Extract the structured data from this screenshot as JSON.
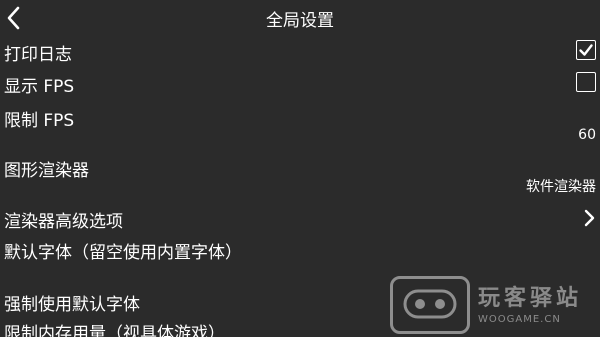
{
  "header": {
    "title": "全局设置",
    "back_icon": "chevron-left-icon"
  },
  "settings": {
    "print_log": {
      "label": "打印日志",
      "checked": true
    },
    "show_fps": {
      "label": "显示 FPS",
      "checked": false
    },
    "limit_fps": {
      "label": "限制 FPS",
      "value": "60"
    },
    "graphics_renderer": {
      "label": "图形渲染器",
      "value": "软件渲染器"
    },
    "renderer_advanced": {
      "label": "渲染器高级选项",
      "icon": "chevron-right-icon"
    },
    "default_font": {
      "label": "默认字体（留空使用内置字体）"
    },
    "force_default_font": {
      "label": "强制使用默认字体"
    },
    "memory_limit": {
      "label": "限制内存用量（视具体游戏）"
    }
  },
  "watermark": {
    "text": "玩客驿站",
    "sub": "WOOGAME.CN"
  },
  "colors": {
    "background": "#2b2b2b",
    "text": "#ffffff"
  }
}
